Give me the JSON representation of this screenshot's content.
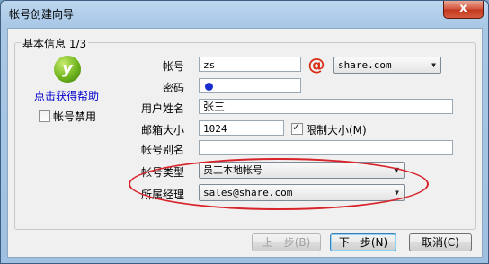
{
  "window": {
    "title": "帐号创建向导",
    "close_glyph": "x"
  },
  "group": {
    "title": "基本信息 1/3"
  },
  "sidebar": {
    "help_link": "点击获得帮助",
    "disable_label": "帐号禁用",
    "disable_checked": false,
    "icon": "help-icon"
  },
  "form": {
    "account_label": "帐号",
    "account_value": "zs",
    "at_symbol": "@",
    "domain_value": "share.com",
    "password_label": "密码",
    "username_label": "用户姓名",
    "username_value": "张三",
    "mailbox_size_label": "邮箱大小",
    "mailbox_size_value": "1024",
    "limit_size_label": "限制大小(M)",
    "limit_size_checked": true,
    "alias_label": "帐号别名",
    "alias_value": "",
    "account_type_label": "帐号类型",
    "account_type_value": "员工本地帐号",
    "manager_label": "所属经理",
    "manager_value": "sales@share.com"
  },
  "buttons": {
    "prev": "上一步(B)",
    "next": "下一步(N)",
    "cancel": "取消(C)"
  },
  "colors": {
    "highlight_oval": "#d8232a",
    "at_sign": "#d92b12",
    "help_link": "#0000cc"
  }
}
